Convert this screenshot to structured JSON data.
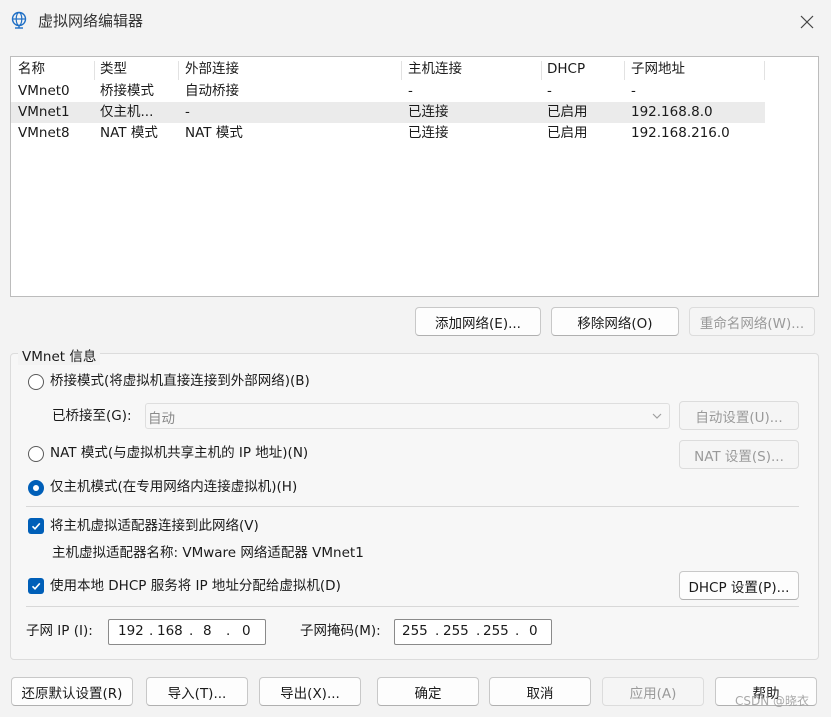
{
  "window": {
    "title": "虚拟网络编辑器",
    "icon": "globe-network-icon",
    "close_icon": "close-icon"
  },
  "list": {
    "columns": [
      "名称",
      "类型",
      "外部连接",
      "主机连接",
      "DHCP",
      "子网地址"
    ],
    "rows": [
      [
        "VMnet0",
        "桥接模式",
        "自动桥接",
        "-",
        "-",
        "-"
      ],
      [
        "VMnet1",
        "仅主机...",
        "-",
        "已连接",
        "已启用",
        "192.168.8.0"
      ],
      [
        "VMnet8",
        "NAT 模式",
        "NAT 模式",
        "已连接",
        "已启用",
        "192.168.216.0"
      ]
    ],
    "selected_row": "VMnet1"
  },
  "list_buttons": {
    "add": "添加网络(E)...",
    "remove": "移除网络(O)",
    "rename": "重命名网络(W)..."
  },
  "vmnet_info": {
    "title": "VMnet 信息",
    "mode_bridged": "桥接模式(将虚拟机直接连接到外部网络)(B)",
    "bridged_to_label": "已桥接至(G):",
    "bridged_to_value": "自动",
    "auto_settings": "自动设置(U)...",
    "mode_nat": "NAT 模式(与虚拟机共享主机的 IP 地址)(N)",
    "nat_settings": "NAT 设置(S)...",
    "mode_hostonly": "仅主机模式(在专用网络内连接虚拟机)(H)",
    "selected_mode": "host-only",
    "connect_adapter": "将主机虚拟适配器连接到此网络(V)",
    "adapter_name": "主机虚拟适配器名称: VMware 网络适配器 VMnet1",
    "use_dhcp": "使用本地 DHCP 服务将 IP 地址分配给虚拟机(D)",
    "dhcp_settings": "DHCP 设置(P)...",
    "subnet_ip_label": "子网 IP (I):",
    "subnet_ip": [
      "192",
      "168",
      "8",
      "0"
    ],
    "subnet_mask_label": "子网掩码(M):",
    "subnet_mask": [
      "255",
      "255",
      "255",
      "0"
    ]
  },
  "footer": {
    "restore": "还原默认设置(R)",
    "import": "导入(T)...",
    "export": "导出(X)...",
    "ok": "确定",
    "cancel": "取消",
    "apply": "应用(A)",
    "help": "帮助"
  },
  "watermark": "CSDN @晓衣",
  "colors": {
    "accent": "#005fb8",
    "selected_row": "#ebebeb",
    "disabled_text": "#9a9a9a"
  }
}
